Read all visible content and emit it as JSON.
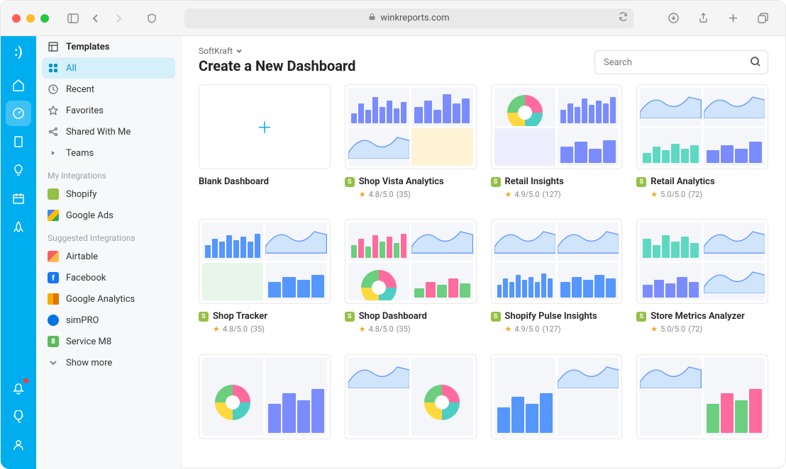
{
  "browser": {
    "url": "winkreports.com"
  },
  "header": {
    "workspace": "SoftKraft",
    "title": "Create a New Dashboard",
    "search_placeholder": "Search"
  },
  "sidebar": {
    "nav": [
      {
        "label": "Templates",
        "icon": "template-icon",
        "bold": true
      },
      {
        "label": "All",
        "icon": "grid-icon",
        "active": true
      },
      {
        "label": "Recent",
        "icon": "clock-icon"
      },
      {
        "label": "Favorites",
        "icon": "star-icon"
      },
      {
        "label": "Shared With Me",
        "icon": "share-icon"
      },
      {
        "label": "Teams",
        "icon": "caret-icon"
      }
    ],
    "my_integrations_heading": "My Integrations",
    "my_integrations": [
      {
        "label": "Shopify",
        "cls": "shopify"
      },
      {
        "label": "Google Ads",
        "cls": "gads"
      }
    ],
    "suggested_heading": "Suggested Integrations",
    "suggested": [
      {
        "label": "Airtable",
        "cls": "airtable"
      },
      {
        "label": "Facebook",
        "cls": "facebook",
        "letter": "f"
      },
      {
        "label": "Google Analytics",
        "cls": "ganalytics"
      },
      {
        "label": "simPRO",
        "cls": "simpro"
      },
      {
        "label": "Service M8",
        "cls": "servicem8",
        "letter": "8"
      }
    ],
    "show_more": "Show more"
  },
  "cards": [
    {
      "title": "Blank Dashboard",
      "blank": true
    },
    {
      "title": "Shop Vista Analytics",
      "rating": "4.8/5.0",
      "count": "(35)",
      "shopify": true,
      "variant": 1
    },
    {
      "title": "Retail Insights",
      "rating": "4.9/5.0",
      "count": "(127)",
      "shopify": true,
      "variant": 2
    },
    {
      "title": "Retail Analytics",
      "rating": "5.0/5.0",
      "count": "(72)",
      "shopify": true,
      "variant": 3
    },
    {
      "title": "Shop Tracker",
      "rating": "4.8/5.0",
      "count": "(35)",
      "shopify": true,
      "variant": 4
    },
    {
      "title": "Shop Dashboard",
      "rating": "4.8/5.0",
      "count": "(35)",
      "shopify": true,
      "variant": 5
    },
    {
      "title": "Shopify Pulse Insights",
      "rating": "4.9/5.0",
      "count": "(127)",
      "shopify": true,
      "variant": 6
    },
    {
      "title": "Store Metrics Analyzer",
      "rating": "5.0/5.0",
      "count": "(72)",
      "shopify": true,
      "variant": 7
    },
    {
      "title": "",
      "partial": true,
      "variant": 8
    },
    {
      "title": "",
      "partial": true,
      "variant": 9
    },
    {
      "title": "",
      "partial": true,
      "variant": 10
    },
    {
      "title": "",
      "partial": true,
      "variant": 11
    }
  ]
}
